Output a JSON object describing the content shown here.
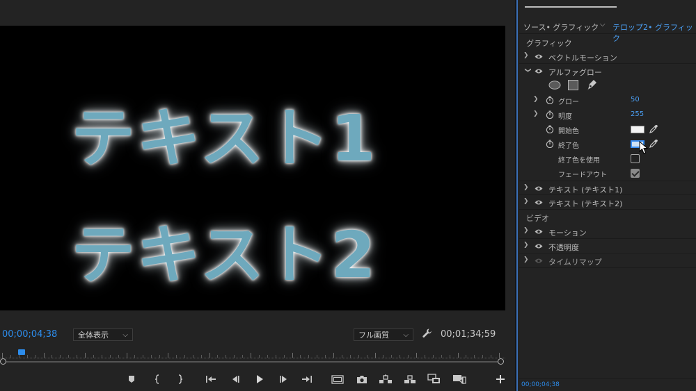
{
  "viewer": {
    "text_line_1": "テキスト1",
    "text_line_2": "テキスト2",
    "text_color": "#6ea9bd",
    "glow_color": "#ffffff"
  },
  "monitor_controls": {
    "current_timecode": "00;00;04;38",
    "fit_dropdown": "全体表示",
    "quality_dropdown": "フル画質",
    "duration_timecode": "00;01;34;59"
  },
  "transport": {
    "icons": [
      "add-marker-icon",
      "mark-in-icon",
      "mark-out-icon",
      "go-to-in-icon",
      "step-back-icon",
      "play-icon",
      "step-forward-icon",
      "go-to-out-icon",
      "safe-margins-icon",
      "export-frame-icon",
      "lift-icon",
      "extract-icon",
      "comparison-view-icon",
      "multicam-icon",
      "add-button-icon"
    ]
  },
  "panel": {
    "header": {
      "source_label": "ソース• グラフィック",
      "sequence_label": "テロップ2• グラフィック"
    },
    "section_graphic": "グラフィック",
    "section_video": "ビデオ",
    "effects": [
      {
        "label": "ベクトルモーション",
        "expanded": false
      },
      {
        "label": "アルファグロー",
        "expanded": true
      }
    ],
    "alpha_glow_props": [
      {
        "label": "グロー",
        "value": "50"
      },
      {
        "label": "明度",
        "value": "255"
      },
      {
        "label": "開始色",
        "color": "#f4f4f4"
      },
      {
        "label": "終了色",
        "color": "#cfe2f5"
      },
      {
        "label": "終了色を使用",
        "checked": false
      },
      {
        "label": "フェードアウト",
        "checked": true
      }
    ],
    "text_layers": [
      {
        "label": "テキスト (テキスト1)"
      },
      {
        "label": "テキスト (テキスト2)"
      }
    ],
    "video_effects": [
      {
        "label": "モーション"
      },
      {
        "label": "不透明度"
      },
      {
        "label": "タイムリマップ"
      }
    ],
    "footer_timecode": "00;00;04;38"
  },
  "colors": {
    "accent_blue": "#2d8ceb",
    "value_blue": "#4a9df0",
    "panel_bg": "#232323"
  }
}
